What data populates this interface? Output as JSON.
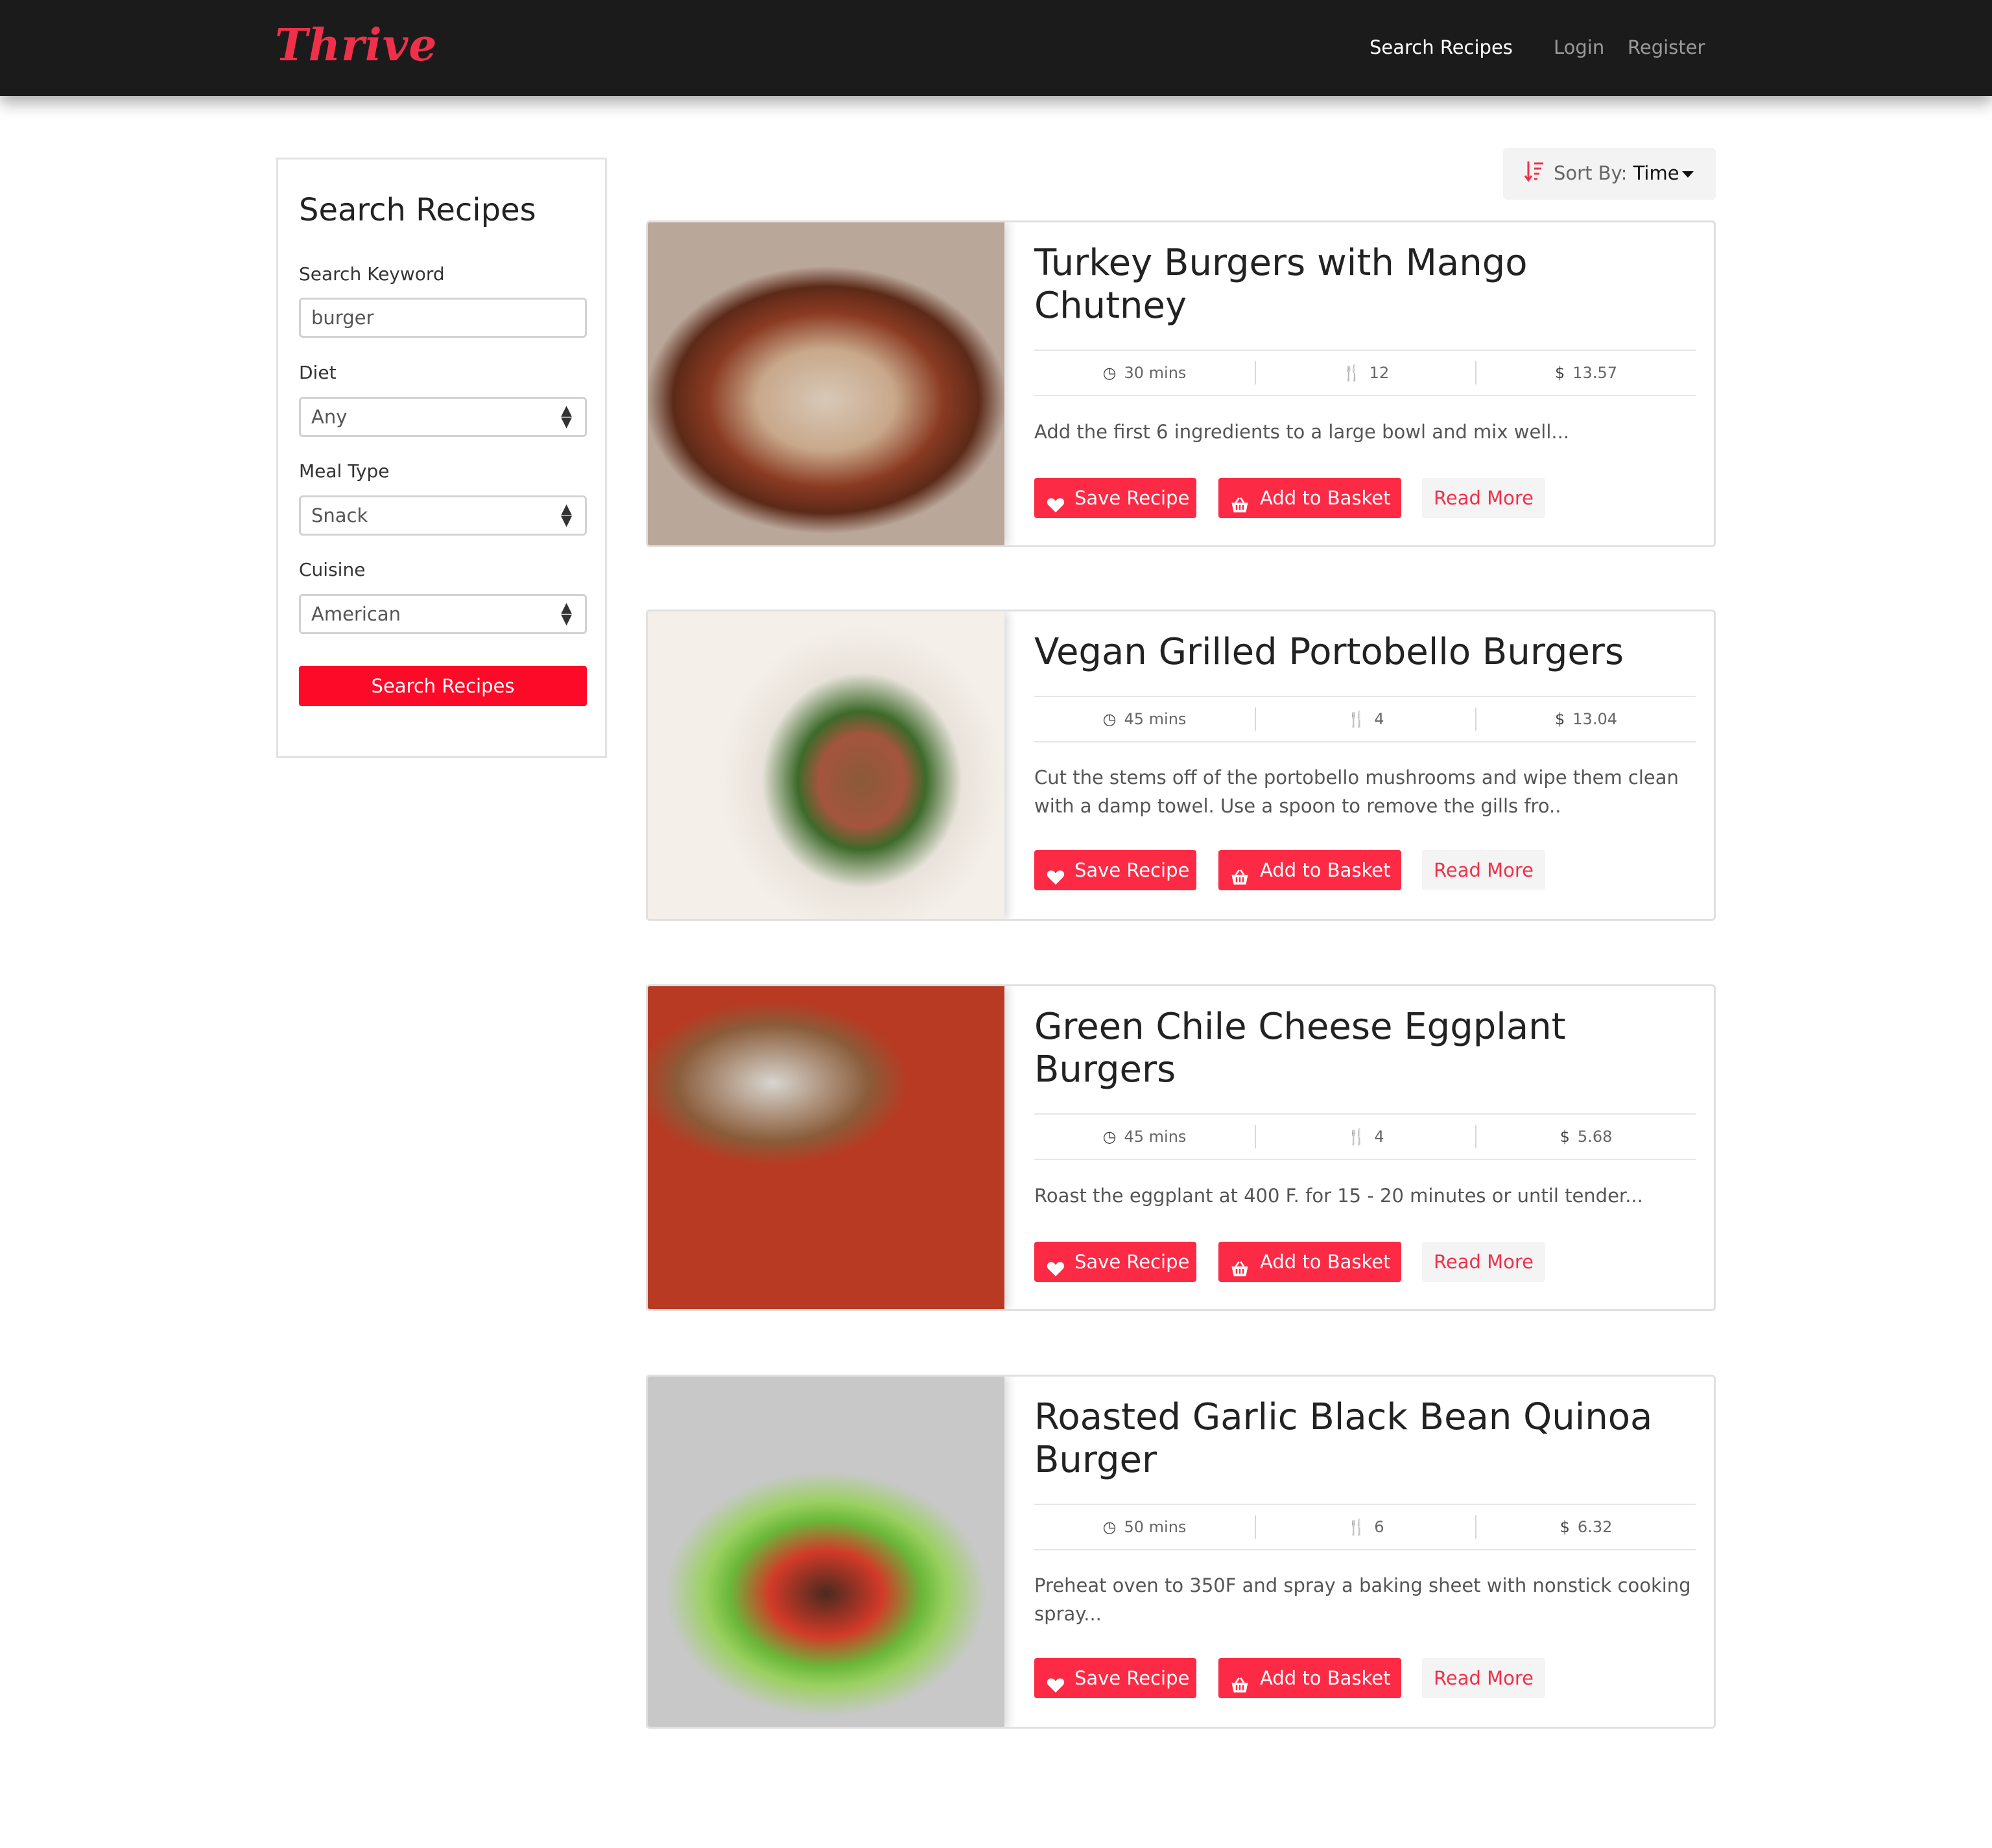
{
  "app": {
    "brand": "Thrive"
  },
  "nav": {
    "search": "Search Recipes",
    "login": "Login",
    "register": "Register"
  },
  "sidebar": {
    "title": "Search Recipes",
    "keyword_label": "Search Keyword",
    "keyword_value": "burger",
    "diet_label": "Diet",
    "diet_value": "Any",
    "meal_label": "Meal Type",
    "meal_value": "Snack",
    "cuisine_label": "Cuisine",
    "cuisine_value": "American",
    "button": "Search Recipes"
  },
  "sort": {
    "label": "Sort By:",
    "value": "Time"
  },
  "buttons": {
    "save": "Save Recipe",
    "basket": "Add to Basket",
    "more": "Read More"
  },
  "recipes": [
    {
      "title": "Turkey Burgers with Mango Chutney",
      "time": "30 mins",
      "servings": "12",
      "price": "13.57",
      "desc": "Add the first 6 ingredients to a large bowl and mix well..."
    },
    {
      "title": "Vegan Grilled Portobello Burgers",
      "time": "45 mins",
      "servings": "4",
      "price": "13.04",
      "desc": "Cut the stems off of the portobello mushrooms and wipe them clean with a damp towel. Use a spoon to remove the gills fro.."
    },
    {
      "title": "Green Chile Cheese Eggplant Burgers",
      "time": "45 mins",
      "servings": "4",
      "price": "5.68",
      "desc": "Roast the eggplant at 400 F. for 15 - 20 minutes or until tender..."
    },
    {
      "title": "Roasted Garlic Black Bean Quinoa Burger",
      "time": "50 mins",
      "servings": "6",
      "price": "6.32",
      "desc": "Preheat oven to 350F and spray a baking sheet with nonstick cooking spray..."
    }
  ],
  "colors": {
    "accent": "#fc2a45",
    "navbar": "#1b1b1b"
  },
  "icons": [
    "clock-icon",
    "utensils-icon",
    "dollar-icon",
    "heart-icon",
    "basket-icon",
    "sort-icon"
  ]
}
